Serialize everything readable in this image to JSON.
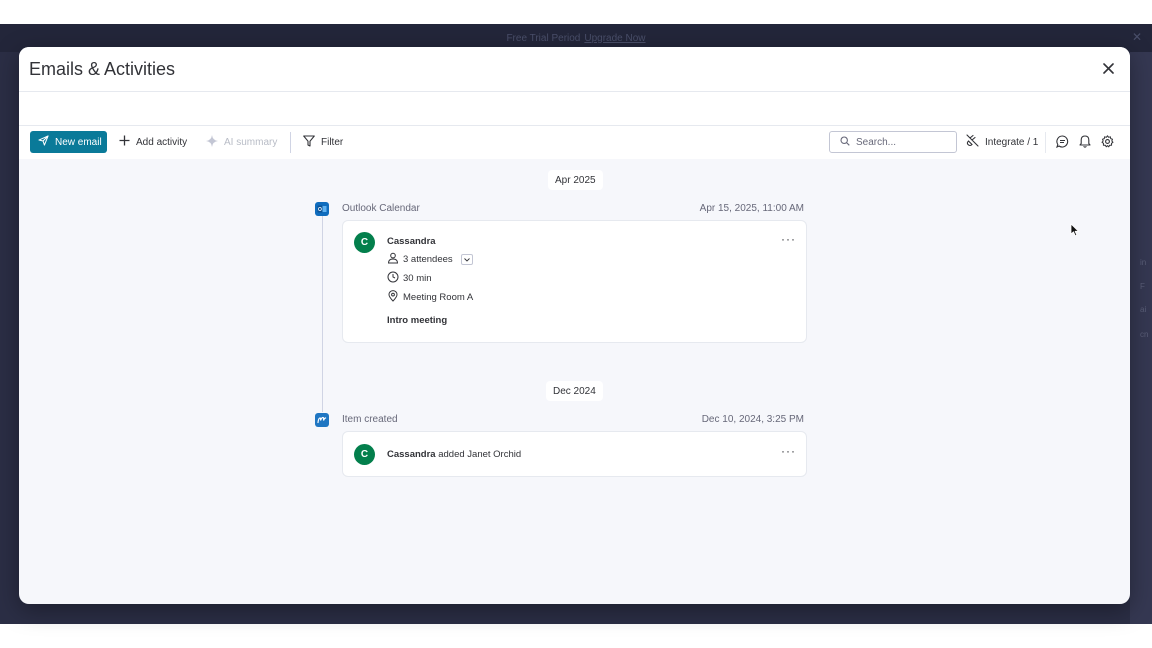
{
  "background": {
    "banner_text": "Free Trial Period",
    "banner_link": "Upgrade Now",
    "side_letters": [
      "in",
      "F",
      "ai",
      "cn"
    ]
  },
  "modal": {
    "title": "Emails & Activities",
    "close_icon": "close-icon"
  },
  "toolbar": {
    "new_email": "New email",
    "add_activity": "Add activity",
    "ai_summary": "AI summary",
    "filter": "Filter",
    "search_placeholder": "Search...",
    "integrate": "Integrate / 1"
  },
  "timeline": {
    "groups": [
      {
        "date_chip": "Apr 2025",
        "source": "Outlook Calendar",
        "datetime": "Apr 15, 2025, 11:00 AM",
        "card": {
          "avatar": "C",
          "name": "Cassandra",
          "attendees": "3 attendees",
          "duration": "30 min",
          "location": "Meeting Room A",
          "subject": "Intro meeting"
        }
      },
      {
        "date_chip": "Dec 2024",
        "source": "Item created",
        "datetime": "Dec 10, 2024, 3:25 PM",
        "card": {
          "avatar": "C",
          "actor": "Cassandra",
          "action": " added Janet Orchid"
        }
      }
    ]
  },
  "colors": {
    "primary": "#0a7a99",
    "avatar": "#037f4c",
    "outlook": "#0f6cbd",
    "monday_item": "#1f76c2"
  }
}
